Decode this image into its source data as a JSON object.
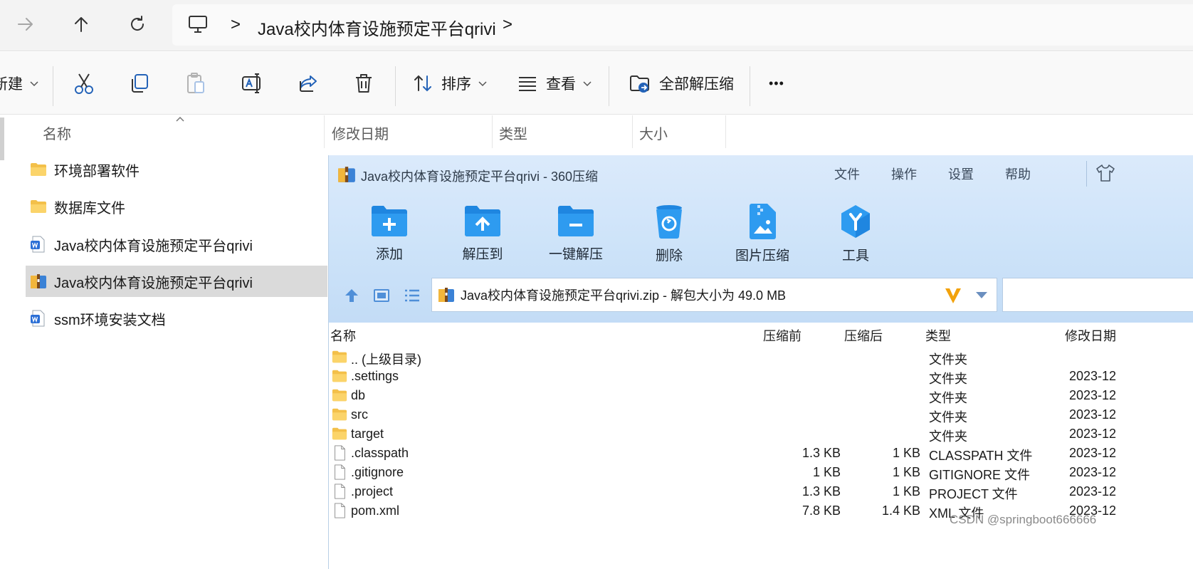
{
  "nav": {
    "path_root_icon": "computer-icon",
    "path_segment": "Java校内体育设施预定平台qrivi",
    "chevron": ">"
  },
  "toolbar": {
    "new_label": "新建",
    "sort_label": "排序",
    "view_label": "查看",
    "extract_all_label": "全部解压缩",
    "more_label": "•••",
    "icons": [
      "cut-icon",
      "copy-icon",
      "paste-icon",
      "rename-icon",
      "share-icon",
      "delete-icon"
    ]
  },
  "columns": {
    "name": "名称",
    "modified": "修改日期",
    "type": "类型",
    "size": "大小"
  },
  "files": [
    {
      "name": "环境部署软件",
      "icon": "folder-icon"
    },
    {
      "name": "数据库文件",
      "icon": "folder-icon"
    },
    {
      "name": "Java校内体育设施预定平台qrivi",
      "icon": "word-doc-icon"
    },
    {
      "name": "Java校内体育设施预定平台qrivi",
      "icon": "zip-archive-icon",
      "selected": true
    },
    {
      "name": "ssm环境安装文档",
      "icon": "word-doc-icon"
    }
  ],
  "zip": {
    "title": "Java校内体育设施预定平台qrivi - 360压缩",
    "menu": [
      "文件",
      "操作",
      "设置",
      "帮助"
    ],
    "tools": [
      "添加",
      "解压到",
      "一键解压",
      "删除",
      "图片压缩",
      "工具"
    ],
    "path": "Java校内体育设施预定平台qrivi.zip - 解包大小为 49.0 MB",
    "columns": {
      "name": "名称",
      "before": "压缩前",
      "after": "压缩后",
      "type": "类型",
      "modified": "修改日期"
    },
    "rows": [
      {
        "name": ".. (上级目录)",
        "before": "",
        "after": "",
        "type": "文件夹",
        "modified": "",
        "kind": "folder"
      },
      {
        "name": ".settings",
        "before": "",
        "after": "",
        "type": "文件夹",
        "modified": "2023-12",
        "kind": "folder"
      },
      {
        "name": "db",
        "before": "",
        "after": "",
        "type": "文件夹",
        "modified": "2023-12",
        "kind": "folder"
      },
      {
        "name": "src",
        "before": "",
        "after": "",
        "type": "文件夹",
        "modified": "2023-12",
        "kind": "folder"
      },
      {
        "name": "target",
        "before": "",
        "after": "",
        "type": "文件夹",
        "modified": "2023-12",
        "kind": "folder"
      },
      {
        "name": ".classpath",
        "before": "1.3 KB",
        "after": "1 KB",
        "type": "CLASSPATH 文件",
        "modified": "2023-12",
        "kind": "file"
      },
      {
        "name": ".gitignore",
        "before": "1 KB",
        "after": "1 KB",
        "type": "GITIGNORE 文件",
        "modified": "2023-12",
        "kind": "file"
      },
      {
        "name": ".project",
        "before": "1.3 KB",
        "after": "1 KB",
        "type": "PROJECT 文件",
        "modified": "2023-12",
        "kind": "file"
      },
      {
        "name": "pom.xml",
        "before": "7.8 KB",
        "after": "1.4 KB",
        "type": "XML 文件",
        "modified": "2023-12",
        "kind": "file"
      }
    ]
  },
  "watermark": "CSDN @springboot666666"
}
